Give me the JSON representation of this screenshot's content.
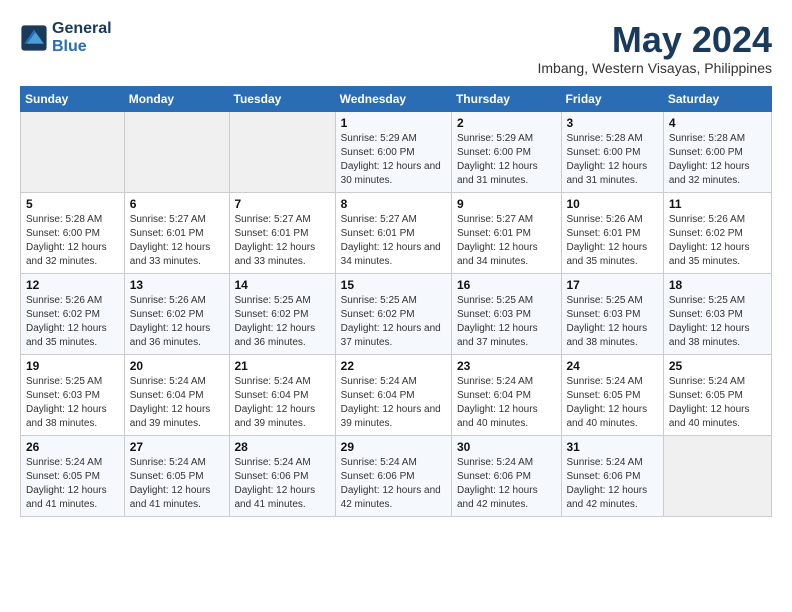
{
  "logo": {
    "line1": "General",
    "line2": "Blue"
  },
  "title": "May 2024",
  "location": "Imbang, Western Visayas, Philippines",
  "weekdays": [
    "Sunday",
    "Monday",
    "Tuesday",
    "Wednesday",
    "Thursday",
    "Friday",
    "Saturday"
  ],
  "weeks": [
    [
      {
        "day": "",
        "sunrise": "",
        "sunset": "",
        "daylight": ""
      },
      {
        "day": "",
        "sunrise": "",
        "sunset": "",
        "daylight": ""
      },
      {
        "day": "",
        "sunrise": "",
        "sunset": "",
        "daylight": ""
      },
      {
        "day": "1",
        "sunrise": "Sunrise: 5:29 AM",
        "sunset": "Sunset: 6:00 PM",
        "daylight": "Daylight: 12 hours and 30 minutes."
      },
      {
        "day": "2",
        "sunrise": "Sunrise: 5:29 AM",
        "sunset": "Sunset: 6:00 PM",
        "daylight": "Daylight: 12 hours and 31 minutes."
      },
      {
        "day": "3",
        "sunrise": "Sunrise: 5:28 AM",
        "sunset": "Sunset: 6:00 PM",
        "daylight": "Daylight: 12 hours and 31 minutes."
      },
      {
        "day": "4",
        "sunrise": "Sunrise: 5:28 AM",
        "sunset": "Sunset: 6:00 PM",
        "daylight": "Daylight: 12 hours and 32 minutes."
      }
    ],
    [
      {
        "day": "5",
        "sunrise": "Sunrise: 5:28 AM",
        "sunset": "Sunset: 6:00 PM",
        "daylight": "Daylight: 12 hours and 32 minutes."
      },
      {
        "day": "6",
        "sunrise": "Sunrise: 5:27 AM",
        "sunset": "Sunset: 6:01 PM",
        "daylight": "Daylight: 12 hours and 33 minutes."
      },
      {
        "day": "7",
        "sunrise": "Sunrise: 5:27 AM",
        "sunset": "Sunset: 6:01 PM",
        "daylight": "Daylight: 12 hours and 33 minutes."
      },
      {
        "day": "8",
        "sunrise": "Sunrise: 5:27 AM",
        "sunset": "Sunset: 6:01 PM",
        "daylight": "Daylight: 12 hours and 34 minutes."
      },
      {
        "day": "9",
        "sunrise": "Sunrise: 5:27 AM",
        "sunset": "Sunset: 6:01 PM",
        "daylight": "Daylight: 12 hours and 34 minutes."
      },
      {
        "day": "10",
        "sunrise": "Sunrise: 5:26 AM",
        "sunset": "Sunset: 6:01 PM",
        "daylight": "Daylight: 12 hours and 35 minutes."
      },
      {
        "day": "11",
        "sunrise": "Sunrise: 5:26 AM",
        "sunset": "Sunset: 6:02 PM",
        "daylight": "Daylight: 12 hours and 35 minutes."
      }
    ],
    [
      {
        "day": "12",
        "sunrise": "Sunrise: 5:26 AM",
        "sunset": "Sunset: 6:02 PM",
        "daylight": "Daylight: 12 hours and 35 minutes."
      },
      {
        "day": "13",
        "sunrise": "Sunrise: 5:26 AM",
        "sunset": "Sunset: 6:02 PM",
        "daylight": "Daylight: 12 hours and 36 minutes."
      },
      {
        "day": "14",
        "sunrise": "Sunrise: 5:25 AM",
        "sunset": "Sunset: 6:02 PM",
        "daylight": "Daylight: 12 hours and 36 minutes."
      },
      {
        "day": "15",
        "sunrise": "Sunrise: 5:25 AM",
        "sunset": "Sunset: 6:02 PM",
        "daylight": "Daylight: 12 hours and 37 minutes."
      },
      {
        "day": "16",
        "sunrise": "Sunrise: 5:25 AM",
        "sunset": "Sunset: 6:03 PM",
        "daylight": "Daylight: 12 hours and 37 minutes."
      },
      {
        "day": "17",
        "sunrise": "Sunrise: 5:25 AM",
        "sunset": "Sunset: 6:03 PM",
        "daylight": "Daylight: 12 hours and 38 minutes."
      },
      {
        "day": "18",
        "sunrise": "Sunrise: 5:25 AM",
        "sunset": "Sunset: 6:03 PM",
        "daylight": "Daylight: 12 hours and 38 minutes."
      }
    ],
    [
      {
        "day": "19",
        "sunrise": "Sunrise: 5:25 AM",
        "sunset": "Sunset: 6:03 PM",
        "daylight": "Daylight: 12 hours and 38 minutes."
      },
      {
        "day": "20",
        "sunrise": "Sunrise: 5:24 AM",
        "sunset": "Sunset: 6:04 PM",
        "daylight": "Daylight: 12 hours and 39 minutes."
      },
      {
        "day": "21",
        "sunrise": "Sunrise: 5:24 AM",
        "sunset": "Sunset: 6:04 PM",
        "daylight": "Daylight: 12 hours and 39 minutes."
      },
      {
        "day": "22",
        "sunrise": "Sunrise: 5:24 AM",
        "sunset": "Sunset: 6:04 PM",
        "daylight": "Daylight: 12 hours and 39 minutes."
      },
      {
        "day": "23",
        "sunrise": "Sunrise: 5:24 AM",
        "sunset": "Sunset: 6:04 PM",
        "daylight": "Daylight: 12 hours and 40 minutes."
      },
      {
        "day": "24",
        "sunrise": "Sunrise: 5:24 AM",
        "sunset": "Sunset: 6:05 PM",
        "daylight": "Daylight: 12 hours and 40 minutes."
      },
      {
        "day": "25",
        "sunrise": "Sunrise: 5:24 AM",
        "sunset": "Sunset: 6:05 PM",
        "daylight": "Daylight: 12 hours and 40 minutes."
      }
    ],
    [
      {
        "day": "26",
        "sunrise": "Sunrise: 5:24 AM",
        "sunset": "Sunset: 6:05 PM",
        "daylight": "Daylight: 12 hours and 41 minutes."
      },
      {
        "day": "27",
        "sunrise": "Sunrise: 5:24 AM",
        "sunset": "Sunset: 6:05 PM",
        "daylight": "Daylight: 12 hours and 41 minutes."
      },
      {
        "day": "28",
        "sunrise": "Sunrise: 5:24 AM",
        "sunset": "Sunset: 6:06 PM",
        "daylight": "Daylight: 12 hours and 41 minutes."
      },
      {
        "day": "29",
        "sunrise": "Sunrise: 5:24 AM",
        "sunset": "Sunset: 6:06 PM",
        "daylight": "Daylight: 12 hours and 42 minutes."
      },
      {
        "day": "30",
        "sunrise": "Sunrise: 5:24 AM",
        "sunset": "Sunset: 6:06 PM",
        "daylight": "Daylight: 12 hours and 42 minutes."
      },
      {
        "day": "31",
        "sunrise": "Sunrise: 5:24 AM",
        "sunset": "Sunset: 6:06 PM",
        "daylight": "Daylight: 12 hours and 42 minutes."
      },
      {
        "day": "",
        "sunrise": "",
        "sunset": "",
        "daylight": ""
      }
    ]
  ]
}
